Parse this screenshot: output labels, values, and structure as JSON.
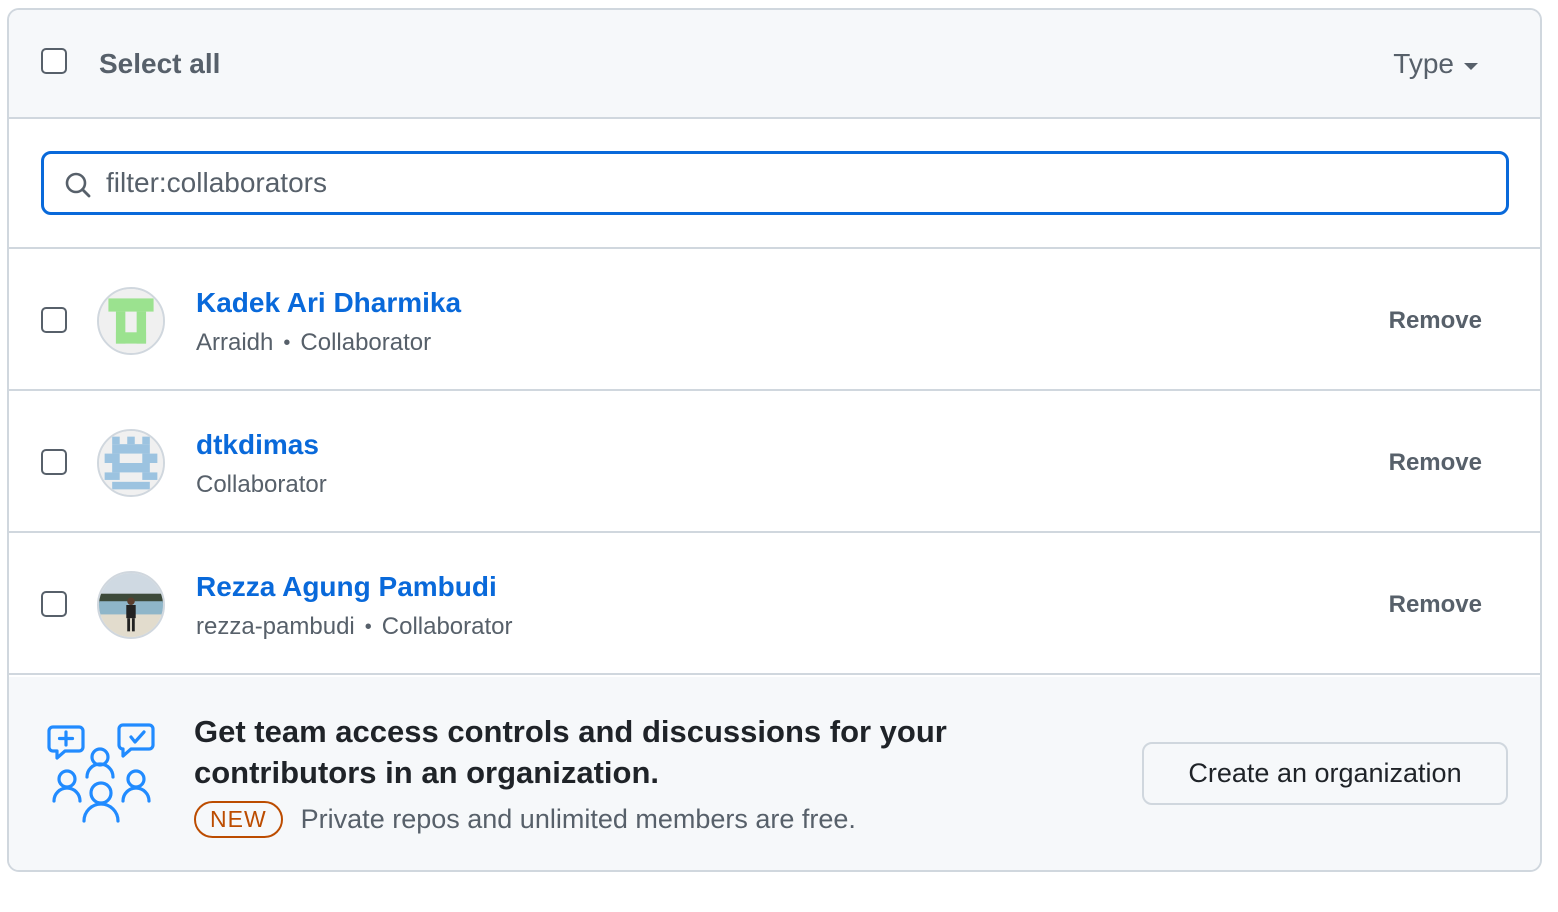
{
  "header": {
    "select_all_label": "Select all",
    "type_label": "Type"
  },
  "search": {
    "value": "filter:collaborators",
    "icon": "search-icon"
  },
  "collaborators": [
    {
      "name": "Kadek Ari Dharmika",
      "username": "Arraidh",
      "role": "Collaborator",
      "action": "Remove",
      "avatar": "identicon-green"
    },
    {
      "name": "dtkdimas",
      "username": "",
      "role": "Collaborator",
      "action": "Remove",
      "avatar": "identicon-blue"
    },
    {
      "name": "Rezza Agung Pambudi",
      "username": "rezza-pambudi",
      "role": "Collaborator",
      "action": "Remove",
      "avatar": "photo-avatar"
    }
  ],
  "separator": "•",
  "promo": {
    "title": "Get team access controls and discussions for your contributors in an organization.",
    "badge": "NEW",
    "subtitle": "Private repos and unlimited members are free.",
    "button_label": "Create an organization",
    "icon": "organization-people-icon"
  },
  "colors": {
    "link": "#0969da",
    "muted": "#57606a",
    "border": "#d0d7de",
    "badge": "#bc4c00",
    "panel_bg": "#f6f8fa"
  }
}
